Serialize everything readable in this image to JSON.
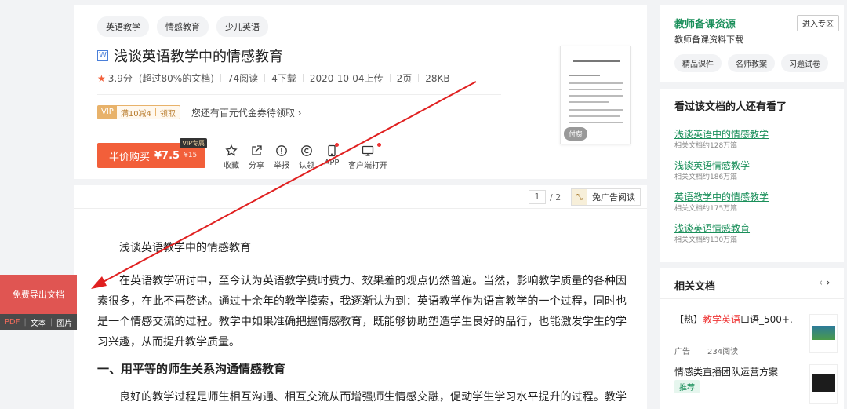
{
  "doc": {
    "tags": [
      "英语教学",
      "情感教育",
      "少儿英语"
    ],
    "file_badge": "W",
    "title": "浅谈英语教学中的情感教育",
    "rating": "3.9分",
    "rating_note": "(超过80%的文档)",
    "reads": "74阅读",
    "downloads": "4下载",
    "upload_date": "2020-10-04上传",
    "pages": "2页",
    "size": "28KB",
    "vip_coupon": {
      "vip": "VIP",
      "offer": "满10减4",
      "claim": "领取"
    },
    "coupon_text": "您还有百元代金券待领取 ›",
    "buy": {
      "label": "半价购买",
      "price": "¥7.5",
      "old_price": "¥15",
      "vip_only": "VIP专属"
    },
    "actions": [
      {
        "label": "收藏",
        "icon": "star-icon"
      },
      {
        "label": "分享",
        "icon": "share-icon"
      },
      {
        "label": "举报",
        "icon": "report-icon"
      },
      {
        "label": "认领",
        "icon": "copyright-icon"
      },
      {
        "label": "APP",
        "icon": "phone-icon"
      },
      {
        "label": "客户端打开",
        "icon": "monitor-icon"
      }
    ],
    "thumb_badge": "付费"
  },
  "viewer": {
    "current_page": "1",
    "total_pages": "/ 2",
    "adfree_label": "免广告阅读"
  },
  "content": {
    "heading": "浅谈英语教学中的情感教育",
    "para1": "在英语教学研讨中，至今认为英语教学费时费力、效果差的观点仍然普遍。当然，影响教学质量的各种因素很多，在此不再赘述。通过十余年的教学摸索，我逐渐认为到：英语教学作为语言教学的一个过程，同时也是一个情感交流的过程。教学中如果准确把握情感教育，既能够协助塑造学生良好的品行，也能激发学生的学习兴趣，从而提升教学质量。",
    "section1": "一、用平等的师生关系沟通情感教育",
    "para2": "良好的教学过程是师生相互沟通、相互交流从而增强师生情感交融，促动学生学习水平提升的过程。教学中应树立民主平等的师生关系，创造和谐轻松的学习氛围，使学生对老师产生信任感、亲近感、亲切感，教"
  },
  "resources": {
    "title": "教师备课资源",
    "subtitle": "教师备课资料下载",
    "enter": "进入专区",
    "tags": [
      "精品课件",
      "名师教案",
      "习题试卷"
    ]
  },
  "also_viewed": {
    "title": "看过该文档的人还有看了",
    "items": [
      {
        "title": "浅谈英语中的情感教学",
        "count": "相关文档约128万篇"
      },
      {
        "title": "浅谈英语情感教学",
        "count": "相关文档约186万篇"
      },
      {
        "title": "英语教学中的情感教学",
        "count": "相关文档约175万篇"
      },
      {
        "title": "浅谈英语情感教育",
        "count": "相关文档约130万篇"
      }
    ]
  },
  "related": {
    "title": "相关文档",
    "item1_prefix": "【热】",
    "item1_highlight": "教学英语",
    "item1_rest": "口语_500+..",
    "ad_label": "广告",
    "ad_reads": "234阅读",
    "item2": "情感类直播团队运营方案",
    "recommend": "推荐"
  },
  "export": {
    "label": "免费导出文档",
    "formats": [
      "PDF",
      "文本",
      "图片"
    ]
  },
  "colors": {
    "accent_green": "#1a8f5a",
    "buy_orange": "#f25f3a",
    "arrow_red": "#e02020",
    "export_red": "#e05552"
  }
}
